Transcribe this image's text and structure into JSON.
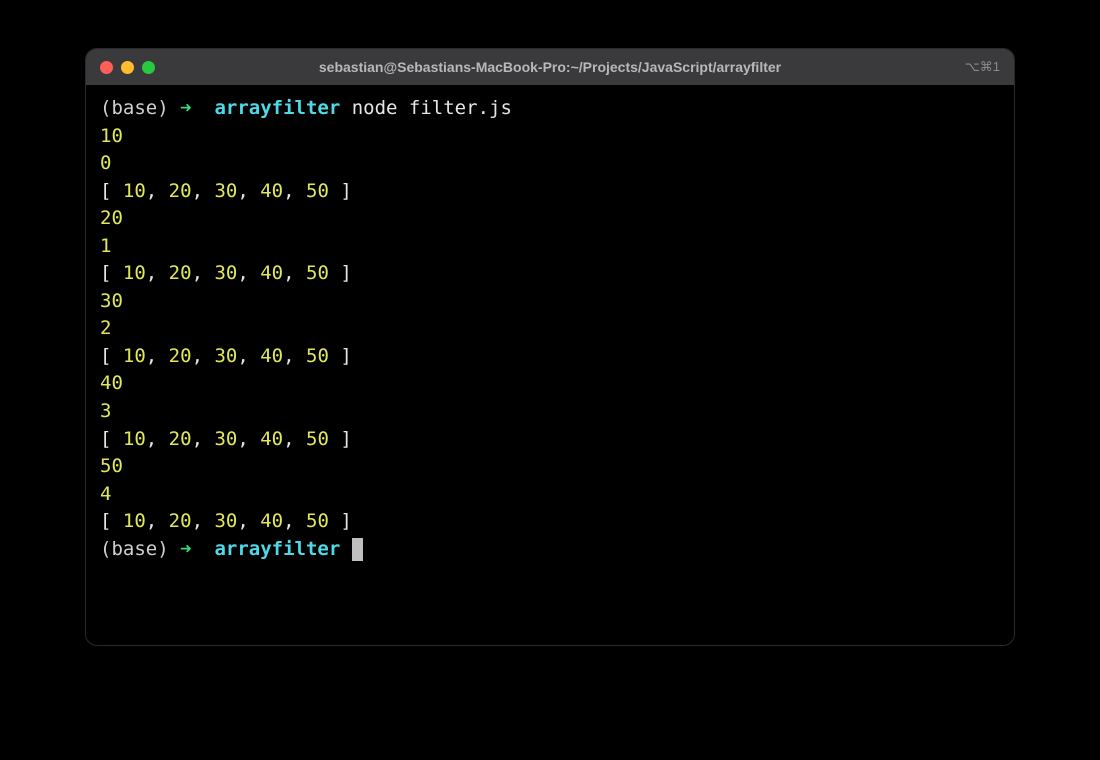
{
  "window": {
    "title": "sebastian@Sebastians-MacBook-Pro:~/Projects/JavaScript/arrayfilter",
    "tab_shortcut": "⌥⌘1"
  },
  "prompt": {
    "env": "(base)",
    "arrow": "➜",
    "dir": "arrayfilter"
  },
  "command": "node filter.js",
  "iterations": [
    {
      "value": "10",
      "index": "0",
      "array": "[ 10, 20, 30, 40, 50 ]"
    },
    {
      "value": "20",
      "index": "1",
      "array": "[ 10, 20, 30, 40, 50 ]"
    },
    {
      "value": "30",
      "index": "2",
      "array": "[ 10, 20, 30, 40, 50 ]"
    },
    {
      "value": "40",
      "index": "3",
      "array": "[ 10, 20, 30, 40, 50 ]"
    },
    {
      "value": "50",
      "index": "4",
      "array": "[ 10, 20, 30, 40, 50 ]"
    }
  ],
  "array_parts": {
    "open": "[ ",
    "close": " ]",
    "sep": ", ",
    "values": [
      "10",
      "20",
      "30",
      "40",
      "50"
    ]
  }
}
